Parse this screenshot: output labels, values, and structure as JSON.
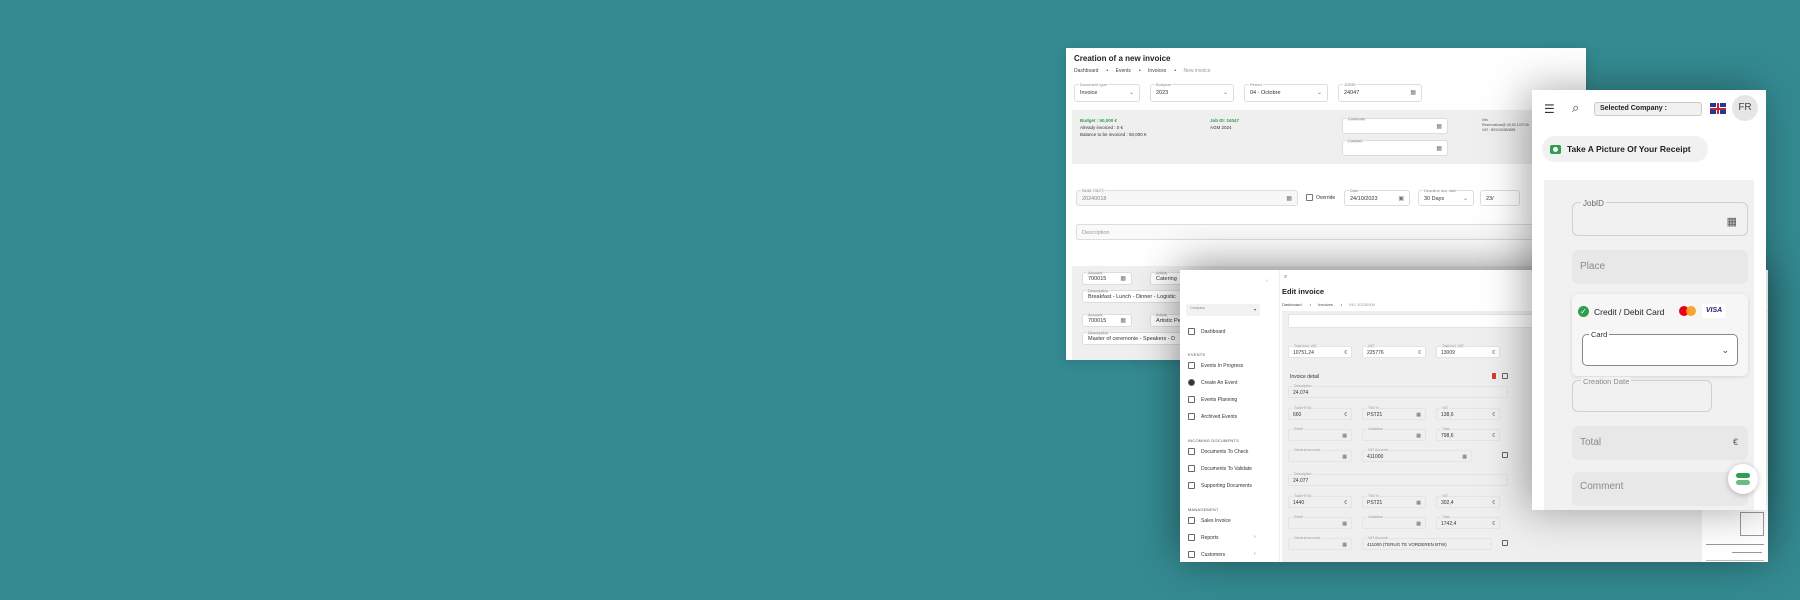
{
  "w1": {
    "title": "Creation of a new invoice",
    "crumbs": [
      "Dashboard",
      "Events",
      "Invoices",
      "New invoice"
    ],
    "fields": {
      "doc_type": {
        "label": "Document type",
        "value": "Invoice"
      },
      "budget_year": {
        "label": "Budyear",
        "value": "2023"
      },
      "period": {
        "label": "Period",
        "value": "04 - Octobre"
      },
      "jobid": {
        "label": "JOBID",
        "value": "24047"
      }
    },
    "budget": {
      "line1": "Budget : 50,000 €",
      "line2": "Already invoiced : 0 €",
      "line3": "Balance to be invoiced : 50,000 €",
      "job": "Job ID: 24047",
      "agm": "AGM 2024"
    },
    "customer_label": "Customer",
    "contact_label": "Contact",
    "info": {
      "l1": "Info",
      "l2": "Reservations@ 60,50 1070 Br",
      "l3": "VAT : BE0430680888"
    },
    "num_fact": {
      "label": "NUM. FACT.",
      "value": "20240018"
    },
    "override": "Override",
    "date": {
      "label": "Date",
      "value": "24/10/2023"
    },
    "deadline": {
      "label": "Deadline due date",
      "value": "30 Days"
    },
    "date2": "23/",
    "description_label": "Description",
    "rows": [
      {
        "account_label": "Account",
        "account": "700015",
        "article_label": "Article",
        "article": "Catering",
        "desc_label": "Description",
        "desc": "Breakfast - Lunch - Dinner - Logistic"
      },
      {
        "account_label": "Account",
        "account": "700015",
        "article_label": "Article",
        "article": "Artistic Pe",
        "desc_label": "Description",
        "desc": "Master of ceremonie - Speakers - D"
      }
    ]
  },
  "w2": {
    "title": "Edit invoice",
    "crumbs": [
      "Dashboard",
      "Invoices",
      "INV 20230006"
    ],
    "company_label": "Company",
    "nav": {
      "dashboard": "Dashboard",
      "events_section": "EVENTS",
      "events_in_progress": "Events In Progress",
      "create_event": "Create An Event",
      "events_planning": "Events Planning",
      "archived_events": "Archived Events",
      "incoming_section": "INCOMING DOCUMENTS",
      "to_check": "Documents To Check",
      "to_validate": "Documents To Validate",
      "supporting": "Supporting Documents",
      "management_section": "MANAGEMENT",
      "sales_invoice": "Sales Invoice",
      "reports": "Reports",
      "customers": "Customers"
    },
    "totals": {
      "excl_label": "Total excl. VAT",
      "excl": "10751,24",
      "vat_label": "VAT",
      "vat": "225776",
      "incl_label": "Total incl. VAT",
      "incl": "13009"
    },
    "detail_label": "Invoice detail",
    "lines": [
      {
        "desc_label": "Description",
        "desc": "24.074",
        "htva_label": "Total HTVA",
        "htva": "660",
        "tva_label": "TVA %",
        "tva": "PST21",
        "vat_label": "VAT",
        "vat": "138,6",
        "event_label": "Event",
        "validation_label": "Validation",
        "total_label": "Total",
        "total": "798,6",
        "general_label": "General account",
        "vat_account_label": "VAT Account",
        "vat_account": "411000"
      },
      {
        "desc_label": "Description",
        "desc": "24.077",
        "htva_label": "Total HTVA",
        "htva": "1440",
        "tva_label": "TVA %",
        "tva": "PST21",
        "vat_label": "VAT",
        "vat": "302,4",
        "event_label": "Event",
        "validation_label": "Validation",
        "total_label": "Total",
        "total": "1742,4",
        "general_label": "General account",
        "vat_account_label": "VAT Account",
        "vat_account": "411000 (TERUG TE VORDEREN BTW)"
      }
    ],
    "euro": "€"
  },
  "w3": {
    "selected_company": "Selected Company :",
    "lang": "FR",
    "take_picture": "Take A Picture Of Your Receipt",
    "jobid": "JobID",
    "place": "Place",
    "payment": "Credit / Debit Card",
    "visa": "VISA",
    "card_label": "Card",
    "creation_date": "Creation Date",
    "total": "Total",
    "comment": "Comment",
    "euro": "€"
  },
  "colors": {
    "background": "#348a91",
    "green": "#2e9e4f",
    "accent_red": "#d93a2b"
  }
}
